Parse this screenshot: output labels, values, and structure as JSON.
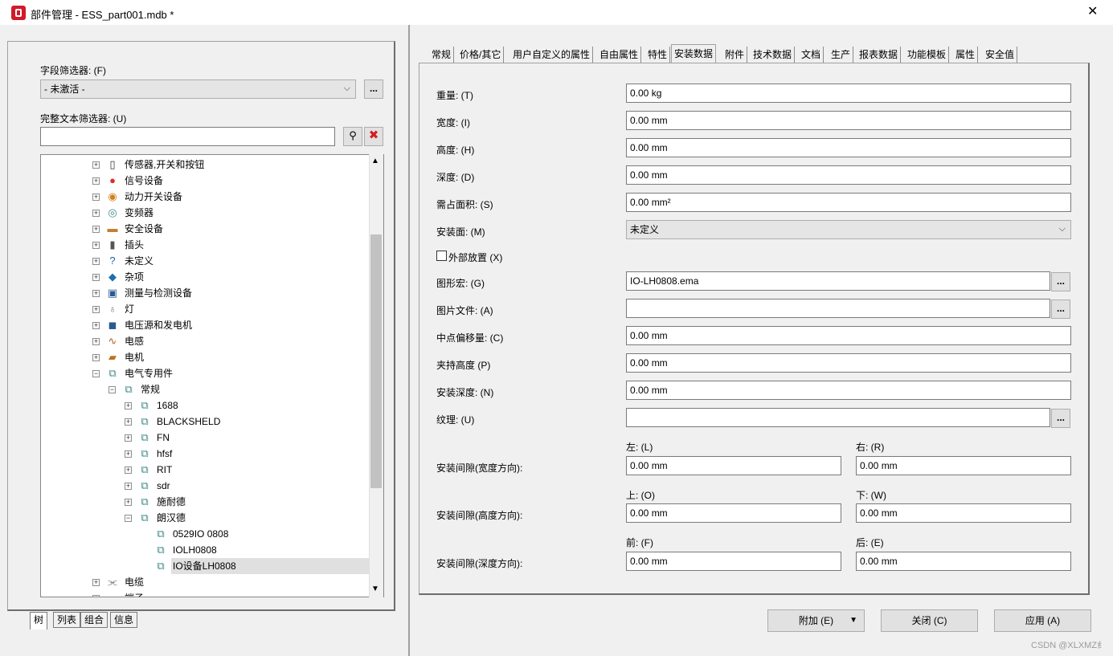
{
  "window": {
    "title": "部件管理 - ESS_part001.mdb *",
    "close_glyph": "✕"
  },
  "left": {
    "field_filter_label": "字段筛选器: (F)",
    "field_filter_value": "- 未激活 -",
    "field_filter_more": "...",
    "fulltext_label": "完整文本筛选器: (U)",
    "fulltext_value": "",
    "tree": [
      {
        "label": "传感器,开关和按钮",
        "icon": "sensor-icon",
        "glyph": "▯",
        "color": "#333"
      },
      {
        "label": "信号设备",
        "icon": "signal-icon",
        "glyph": "●",
        "color": "#d83030"
      },
      {
        "label": "动力开关设备",
        "icon": "power-switch-icon",
        "glyph": "◉",
        "color": "#d08020"
      },
      {
        "label": "变频器",
        "icon": "inverter-icon",
        "glyph": "◎",
        "color": "#3a8a8a"
      },
      {
        "label": "安全设备",
        "icon": "safety-icon",
        "glyph": "▬",
        "color": "#c08030"
      },
      {
        "label": "插头",
        "icon": "plug-icon",
        "glyph": "▮",
        "color": "#555"
      },
      {
        "label": "未定义",
        "icon": "question-icon",
        "glyph": "?",
        "color": "#1f5fa0"
      },
      {
        "label": "杂项",
        "icon": "misc-icon",
        "glyph": "◆",
        "color": "#1f6fb0"
      },
      {
        "label": "测量与检测设备",
        "icon": "measure-icon",
        "glyph": "▣",
        "color": "#2a5a90"
      },
      {
        "label": "灯",
        "icon": "lamp-icon",
        "glyph": "♁",
        "color": "#777"
      },
      {
        "label": "电压源和发电机",
        "icon": "generator-icon",
        "glyph": "◼",
        "color": "#2a5a90"
      },
      {
        "label": "电感",
        "icon": "inductor-icon",
        "glyph": "∿",
        "color": "#b06020"
      },
      {
        "label": "电机",
        "icon": "motor-icon",
        "glyph": "▰",
        "color": "#c07020"
      },
      {
        "label": "电气专用件",
        "icon": "electric-special-icon",
        "glyph": "⧉",
        "color": "#3a8a8a"
      },
      {
        "label": "常规",
        "icon": "folder-general-icon",
        "glyph": "⧉",
        "color": "#3a8a8a"
      },
      {
        "label": "1688",
        "icon": "part-group-icon",
        "glyph": "⧉",
        "color": "#3a8a8a"
      },
      {
        "label": "BLACKSHELD",
        "icon": "part-group-icon",
        "glyph": "⧉",
        "color": "#3a8a8a"
      },
      {
        "label": "FN",
        "icon": "part-group-icon",
        "glyph": "⧉",
        "color": "#3a8a8a"
      },
      {
        "label": "hfsf",
        "icon": "part-group-icon",
        "glyph": "⧉",
        "color": "#3a8a8a"
      },
      {
        "label": "RIT",
        "icon": "part-group-icon",
        "glyph": "⧉",
        "color": "#3a8a8a"
      },
      {
        "label": "sdr",
        "icon": "part-group-icon",
        "glyph": "⧉",
        "color": "#3a8a8a"
      },
      {
        "label": "施耐德",
        "icon": "part-group-icon",
        "glyph": "⧉",
        "color": "#3a8a8a"
      },
      {
        "label": "朗汉德",
        "icon": "part-group-icon",
        "glyph": "⧉",
        "color": "#3a8a8a"
      },
      {
        "label": "0529IO 0808",
        "icon": "part-icon",
        "glyph": "⧉",
        "color": "#3a8a8a"
      },
      {
        "label": "IOLH0808",
        "icon": "part-icon",
        "glyph": "⧉",
        "color": "#3a8a8a"
      },
      {
        "label": "IO设备LH0808",
        "icon": "part-icon",
        "glyph": "⧉",
        "color": "#3a8a8a"
      },
      {
        "label": "电缆",
        "icon": "cable-icon",
        "glyph": "⫘",
        "color": "#555"
      },
      {
        "label": "端子",
        "icon": "terminal-icon",
        "glyph": "▬",
        "color": "#3a8a8a"
      }
    ],
    "bottom_tabs": [
      "树",
      "列表",
      "组合",
      "信息"
    ]
  },
  "tabs": [
    "常规",
    "价格/其它",
    "用户自定义的属性",
    "自由属性",
    "特性",
    "安装数据",
    "附件",
    "技术数据",
    "文档",
    "生产",
    "报表数据",
    "功能模板",
    "属性",
    "安全值"
  ],
  "form": {
    "weight_label": "重量: (T)",
    "weight_value": "0.00 kg",
    "width_label": "宽度: (I)",
    "width_value": "0.00 mm",
    "height_label": "高度: (H)",
    "height_value": "0.00 mm",
    "depth_label": "深度: (D)",
    "depth_value": "0.00 mm",
    "area_label": "需占面积: (S)",
    "area_value": "0.00 mm²",
    "mount_surface_label": "安装面: (M)",
    "mount_surface_value": "未定义",
    "external_label": "外部放置 (X)",
    "graphic_macro_label": "图形宏: (G)",
    "graphic_macro_value": "IO-LH0808.ema",
    "image_file_label": "图片文件: (A)",
    "image_file_value": "",
    "center_offset_label": "中点偏移量: (C)",
    "center_offset_value": "0.00 mm",
    "clamp_height_label": "夹持高度 (P)",
    "clamp_height_value": "0.00 mm",
    "mount_depth_label": "安装深度: (N)",
    "mount_depth_value": "0.00 mm",
    "texture_label": "纹理: (U)",
    "texture_value": "",
    "more": "...",
    "clearance_width_label": "安装间隙(宽度方向):",
    "left_label": "左: (L)",
    "left_value": "0.00 mm",
    "right_label": "右: (R)",
    "right_value": "0.00 mm",
    "clearance_height_label": "安装间隙(高度方向):",
    "top_label": "上: (O)",
    "top_value": "0.00 mm",
    "bottom_label": "下: (W)",
    "bottom_value": "0.00 mm",
    "clearance_depth_label": "安装间隙(深度方向):",
    "front_label": "前: (F)",
    "front_value": "0.00 mm",
    "back_label": "后: (E)",
    "back_value": "0.00 mm"
  },
  "footer": {
    "add_label": "附加 (E)",
    "close_label": "关闭 (C)",
    "apply_label": "应用 (A)",
    "watermark": "CSDN @XLXMZ纟"
  }
}
